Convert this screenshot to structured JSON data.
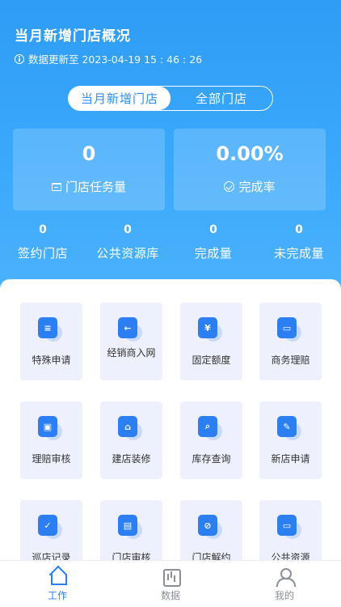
{
  "header": {
    "title": "当月新增门店概况",
    "update_text": "数据更新至 2023-04-19 15 : 46 : 26"
  },
  "segment": {
    "tabs": [
      "当月新增门店",
      "全部门店"
    ],
    "active": "当月新增门店"
  },
  "cards": [
    {
      "value": "0",
      "label": "门店任务量",
      "icon": "store-icon"
    },
    {
      "value": "0.00%",
      "label": "完成率",
      "icon": "check-circle-icon"
    }
  ],
  "stats": [
    {
      "value": "0",
      "label": "签约门店"
    },
    {
      "value": "0",
      "label": "公共资源库"
    },
    {
      "value": "0",
      "label": "完成量"
    },
    {
      "value": "0",
      "label": "未完成量"
    }
  ],
  "menu": [
    {
      "label": "特殊申请",
      "icon": "message-icon",
      "glyph": "≡"
    },
    {
      "label": "经销商入网",
      "icon": "back-arrow-icon",
      "glyph": "←"
    },
    {
      "label": "固定额度",
      "icon": "yen-icon",
      "glyph": "¥"
    },
    {
      "label": "商务理赔",
      "icon": "briefcase-icon",
      "glyph": "▭"
    },
    {
      "label": "理赔审核",
      "icon": "badge-icon",
      "glyph": "▣"
    },
    {
      "label": "建店装修",
      "icon": "shop-icon",
      "glyph": "⌂"
    },
    {
      "label": "库存查询",
      "icon": "box-search-icon",
      "glyph": "⌕"
    },
    {
      "label": "新店申请",
      "icon": "edit-doc-icon",
      "glyph": "✎"
    },
    {
      "label": "巡店记录",
      "icon": "checklist-icon",
      "glyph": "✓"
    },
    {
      "label": "门店审核",
      "icon": "stamp-icon",
      "glyph": "▤"
    },
    {
      "label": "门店解约",
      "icon": "cancel-doc-icon",
      "glyph": "⊘"
    },
    {
      "label": "公共资源",
      "icon": "inbox-icon",
      "glyph": "▭"
    }
  ],
  "tabbar": [
    {
      "label": "工作",
      "icon": "home-icon",
      "active": true
    },
    {
      "label": "数据",
      "icon": "chart-icon",
      "active": false
    },
    {
      "label": "我的",
      "icon": "user-icon",
      "active": false
    }
  ],
  "colors": {
    "primary": "#2c7ef3",
    "header_gradient_top": "#2f9cf5",
    "tile_bg": "#eef1fd"
  }
}
